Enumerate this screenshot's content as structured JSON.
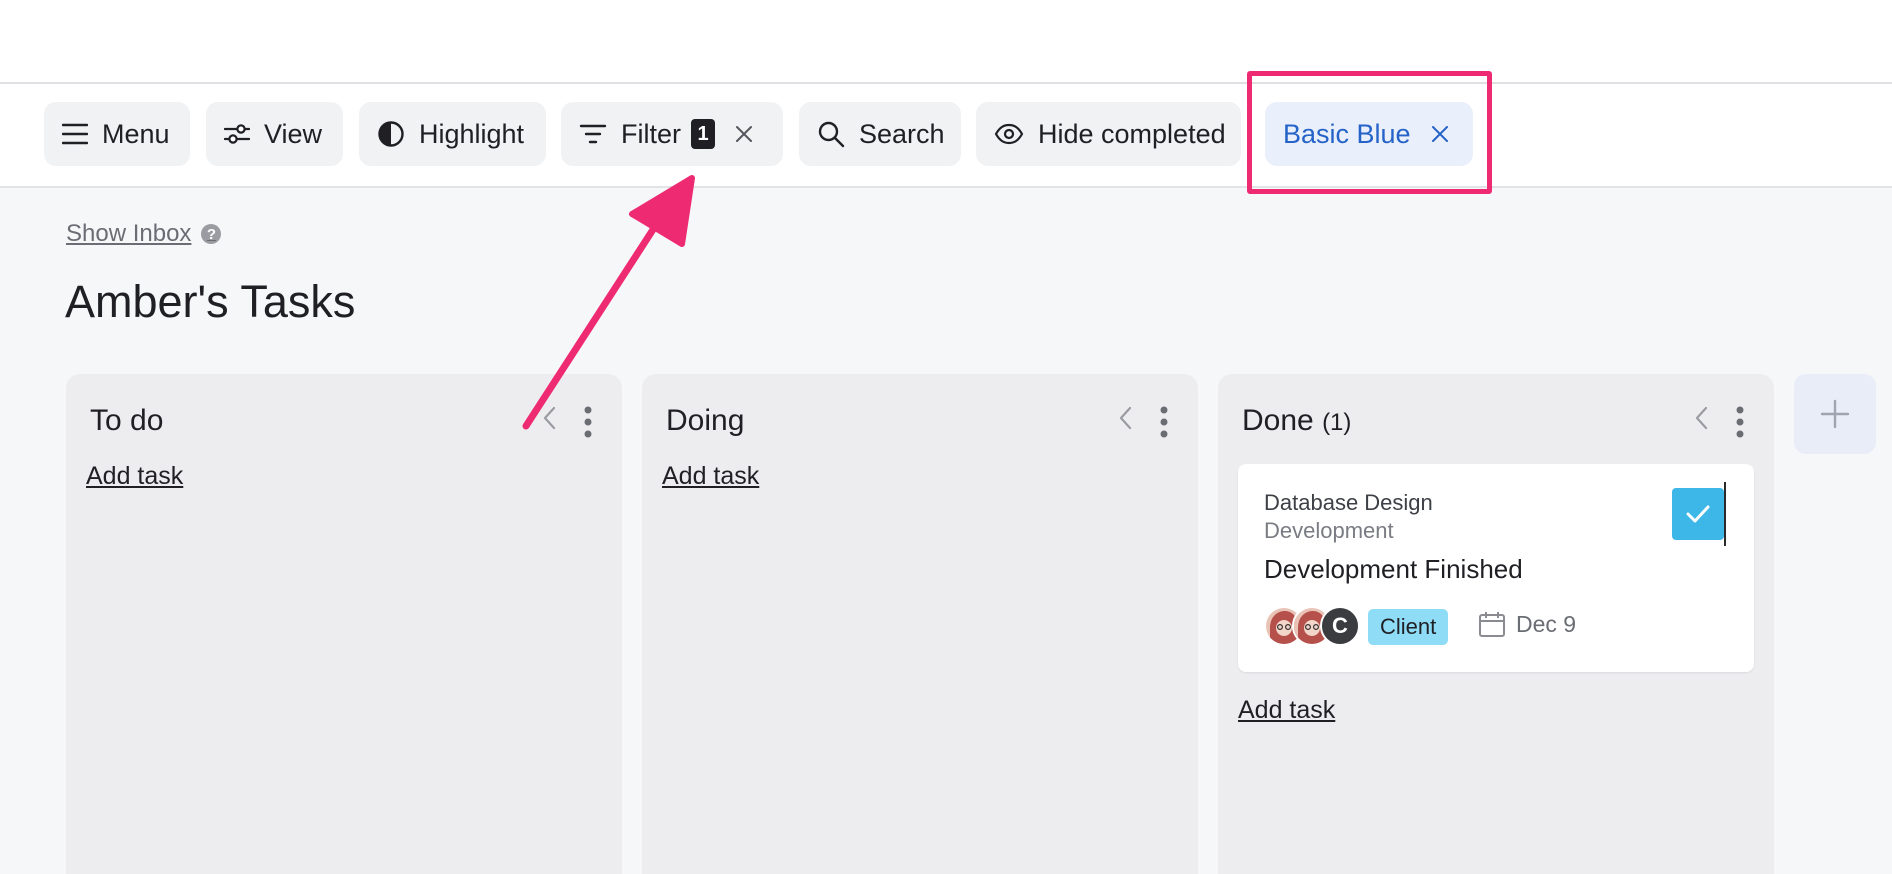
{
  "toolbar": {
    "menu_label": "Menu",
    "view_label": "View",
    "highlight_label": "Highlight",
    "filter_label": "Filter",
    "filter_count": "1",
    "search_label": "Search",
    "hide_completed_label": "Hide completed",
    "active_filter_label": "Basic Blue"
  },
  "page": {
    "show_inbox": "Show Inbox",
    "help_symbol": "?",
    "title": "Amber's Tasks"
  },
  "columns": [
    {
      "title": "To do",
      "count": "",
      "add_task": "Add task"
    },
    {
      "title": "Doing",
      "count": "",
      "add_task": "Add task"
    },
    {
      "title": "Done",
      "count": "(1)",
      "add_task": "Add task"
    }
  ],
  "card": {
    "project": "Database Design",
    "section": "Development",
    "title": "Development Finished",
    "avatar_initial": "C",
    "tag": "Client",
    "due_date": "Dec 9",
    "completed": true
  },
  "colors": {
    "annotation_pink": "#ee2b72",
    "filter_chip_blue": "#2563c8",
    "check_blue": "#3db7e8",
    "tag_blue": "#8fdcf6"
  },
  "icons": [
    "menu-icon",
    "sliders-icon",
    "contrast-icon",
    "filter-icon",
    "close-icon",
    "search-icon",
    "eye-icon",
    "chevron-left-icon",
    "more-vertical-icon",
    "plus-icon",
    "check-icon",
    "calendar-icon",
    "help-icon"
  ]
}
